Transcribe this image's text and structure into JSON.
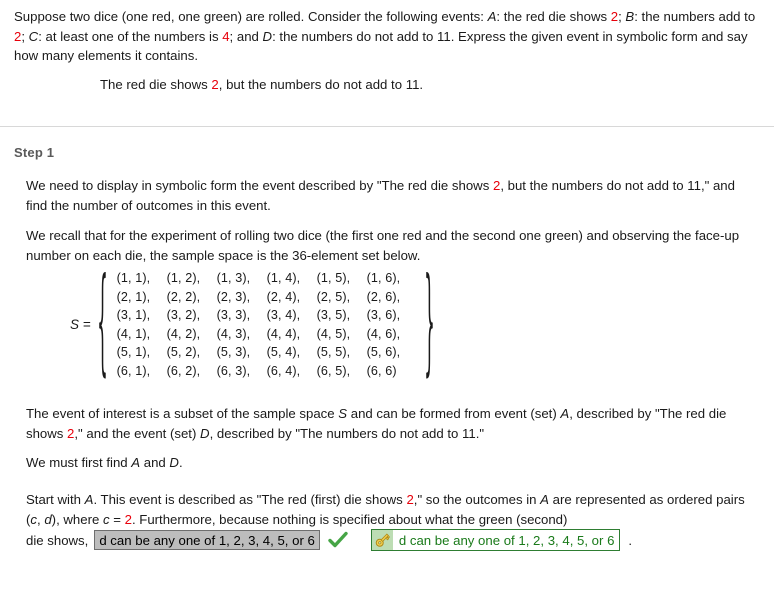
{
  "problem": {
    "statement_parts": [
      {
        "text": "Suppose two dice (one red, one green) are rolled. Consider the following events: "
      },
      {
        "text": "A",
        "style": "italic"
      },
      {
        "text": ": the red die shows "
      },
      {
        "text": "2",
        "style": "red"
      },
      {
        "text": "; "
      },
      {
        "text": "B",
        "style": "italic"
      },
      {
        "text": ": the numbers add to "
      },
      {
        "text": "2",
        "style": "red"
      },
      {
        "text": "; "
      },
      {
        "text": "C",
        "style": "italic"
      },
      {
        "text": ": at least one of the numbers is "
      },
      {
        "text": "4",
        "style": "red"
      },
      {
        "text": "; and "
      },
      {
        "text": "D",
        "style": "italic"
      },
      {
        "text": ": the numbers do not add to 11. Express the given event in symbolic form and say how many elements it contains."
      }
    ],
    "given_event_parts": [
      {
        "text": "The red die shows "
      },
      {
        "text": "2",
        "style": "red"
      },
      {
        "text": ", but the numbers do not add to 11."
      }
    ]
  },
  "step": {
    "heading": "Step 1",
    "para_display_parts": [
      {
        "text": "We need to display in symbolic form the event described by \"The red die shows "
      },
      {
        "text": "2",
        "style": "red"
      },
      {
        "text": ", but the numbers do not add to 11,\" and find the number of outcomes in this event."
      }
    ],
    "para_recall_parts": [
      {
        "text": "We recall that for the experiment of rolling two dice (the first one red and the second one green) and observing the face-up number on each die, the sample space is the 36-element set below."
      }
    ],
    "para_subset_parts": [
      {
        "text": "The event of interest is a subset of the sample space "
      },
      {
        "text": "S",
        "style": "italic"
      },
      {
        "text": " and can be formed from event (set) "
      },
      {
        "text": "A",
        "style": "italic"
      },
      {
        "text": ", described by \"The red die shows "
      },
      {
        "text": "2",
        "style": "red"
      },
      {
        "text": ",\" and the event (set) "
      },
      {
        "text": "D",
        "style": "italic"
      },
      {
        "text": ", described by \"The numbers do not add to 11.\""
      }
    ],
    "para_find_parts": [
      {
        "text": "We must first find "
      },
      {
        "text": "A",
        "style": "italic"
      },
      {
        "text": " and "
      },
      {
        "text": "D",
        "style": "italic"
      },
      {
        "text": "."
      }
    ],
    "para_start_parts": [
      {
        "text": "Start with "
      },
      {
        "text": "A",
        "style": "italic"
      },
      {
        "text": ". This event is described as \"The red (first) die shows "
      },
      {
        "text": "2",
        "style": "red"
      },
      {
        "text": ",\" so the outcomes in "
      },
      {
        "text": "A",
        "style": "italic"
      },
      {
        "text": " are represented as ordered pairs ("
      },
      {
        "text": "c",
        "style": "italic"
      },
      {
        "text": ", "
      },
      {
        "text": "d",
        "style": "italic"
      },
      {
        "text": "), where "
      },
      {
        "text": "c",
        "style": "italic"
      },
      {
        "text": " = "
      },
      {
        "text": "2",
        "style": "red"
      },
      {
        "text": ". Furthermore, because nothing is specified about what the green (second)"
      }
    ]
  },
  "sample_space": {
    "label": "S =",
    "open_brace": "{",
    "close_brace": "}",
    "rows": [
      [
        "(1, 1),",
        "(1, 2),",
        "(1, 3),",
        "(1, 4),",
        "(1, 5),",
        "(1, 6),"
      ],
      [
        "(2, 1),",
        "(2, 2),",
        "(2, 3),",
        "(2, 4),",
        "(2, 5),",
        "(2, 6),"
      ],
      [
        "(3, 1),",
        "(3, 2),",
        "(3, 3),",
        "(3, 4),",
        "(3, 5),",
        "(3, 6),"
      ],
      [
        "(4, 1),",
        "(4, 2),",
        "(4, 3),",
        "(4, 4),",
        "(4, 5),",
        "(4, 6),"
      ],
      [
        "(5, 1),",
        "(5, 2),",
        "(5, 3),",
        "(5, 4),",
        "(5, 5),",
        "(5, 6),"
      ],
      [
        "(6, 1),",
        "(6, 2),",
        "(6, 3),",
        "(6, 4),",
        "(6, 5),",
        "(6, 6)"
      ]
    ]
  },
  "answer_line": {
    "prefix": "die shows,",
    "select_value": "d can be any one of 1, 2, 3, 4, 5, or 6",
    "select_options": [
      "d can be any one of 1, 2, 3, 4, 5, or 6"
    ],
    "check_icon": "check-icon",
    "key_icon": "key-icon",
    "answer_key_value": "d can be any one of 1, 2, 3, 4, 5, or 6",
    "period": "."
  },
  "colors": {
    "accent_red": "#e8000b",
    "answer_green": "#1a7a1a",
    "check_green": "#46a546",
    "key_gold": "#e8c341",
    "select_gray": "#bdbdbd"
  }
}
